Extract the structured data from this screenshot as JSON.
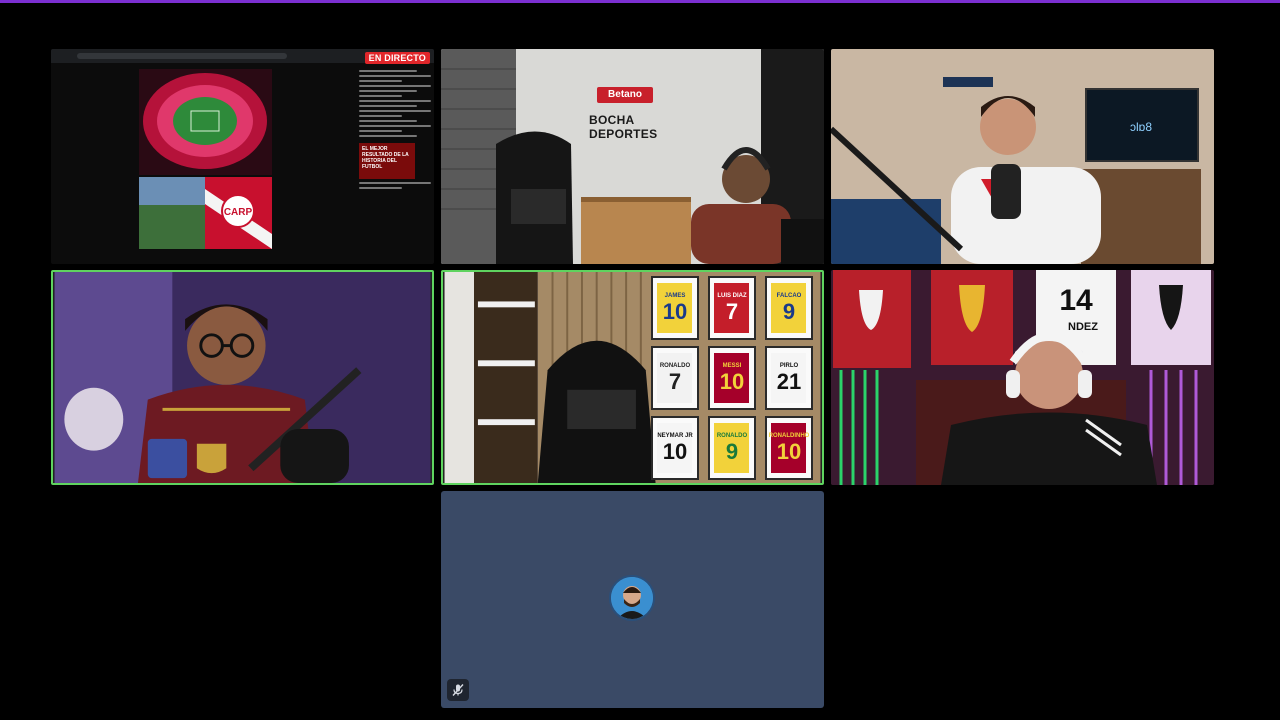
{
  "screen_share": {
    "live_badge": "EN DIRECTO",
    "promo_text": "EL MEJOR RESULTADO DE LA HISTORIA DEL FUTBOL"
  },
  "studio": {
    "brand_sign": "Betano",
    "banner": "BOCHA DEPORTES"
  },
  "jerseys": [
    {
      "name": "JAMES",
      "number": "10"
    },
    {
      "name": "LUIS DIAZ",
      "number": "7"
    },
    {
      "name": "FALCAO",
      "number": "9"
    },
    {
      "name": "RONALDO",
      "number": "7"
    },
    {
      "name": "MESSI",
      "number": "10"
    },
    {
      "name": "PIRLO",
      "number": "21"
    },
    {
      "name": "NEYMAR JR",
      "number": "10"
    },
    {
      "name": "RONALDO",
      "number": "9"
    },
    {
      "name": "RONALDINHO",
      "number": "10"
    }
  ],
  "wall_jersey": {
    "number": "14",
    "name": "NDEZ"
  },
  "colors": {
    "speaking_border": "#5fd35f",
    "live_badge": "#e0262a",
    "avatar_tile_bg": "#3a4a66",
    "accent_bar": "#7b2fd1"
  },
  "icons": {
    "muted": "mic-off-icon"
  }
}
